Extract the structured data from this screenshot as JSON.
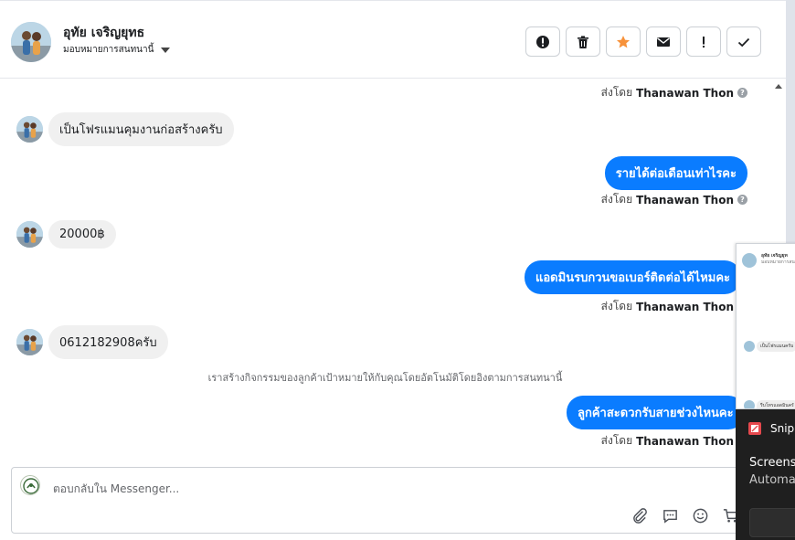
{
  "header": {
    "contact_name": "อุทัย เจริญยุทธ",
    "assign_label": "มอบหมายการสนทนานี้",
    "accent_color": "#f7923a"
  },
  "actions": [
    {
      "name": "spam-button",
      "icon": "exclamation-circle-icon"
    },
    {
      "name": "delete-button",
      "icon": "trash-icon"
    },
    {
      "name": "star-button",
      "icon": "star-icon"
    },
    {
      "name": "mark-unread-button",
      "icon": "envelope-icon"
    },
    {
      "name": "follow-up-button",
      "icon": "exclamation-icon"
    },
    {
      "name": "mark-done-button",
      "icon": "checkmark-icon"
    }
  ],
  "messages": {
    "sent_by_prefix": "ส่งโดย",
    "agent_name": "Thanawan Thon",
    "m1": "เป็นโฟรแมนคุมงานก่อสร้างครับ",
    "m2": "รายได้ต่อเดือนเท่าไรคะ",
    "m3": "20000฿",
    "m4": "แอดมินรบกวนขอเบอร์ติดต่อได้ไหมคะ",
    "m5": "0612182908ครับ",
    "system_note": "เราสร้างกิจกรรมของลูกค้าเป้าหมายให้กับคุณโดยอัตโนมัติโดยอิงตามการสนทนานี้",
    "m6": "ลูกค้าสะดวกรับสายช่วงไหนคะ",
    "out_color": "#0a7cff",
    "in_color": "#f0f0f0"
  },
  "composer": {
    "placeholder": "ตอบกลับใน Messenger..."
  },
  "mini_window": {
    "name_line": "อุทัย เจริญยุท",
    "sub_line": "มอบหมายการสนทนา",
    "bubble1": "เป็นโฟรแมนครับ",
    "bubble2": "รีบโทรแอดมินครับ"
  },
  "snip_panel": {
    "app_name": "Snip",
    "line1": "Screensh",
    "line2": "Automat"
  }
}
